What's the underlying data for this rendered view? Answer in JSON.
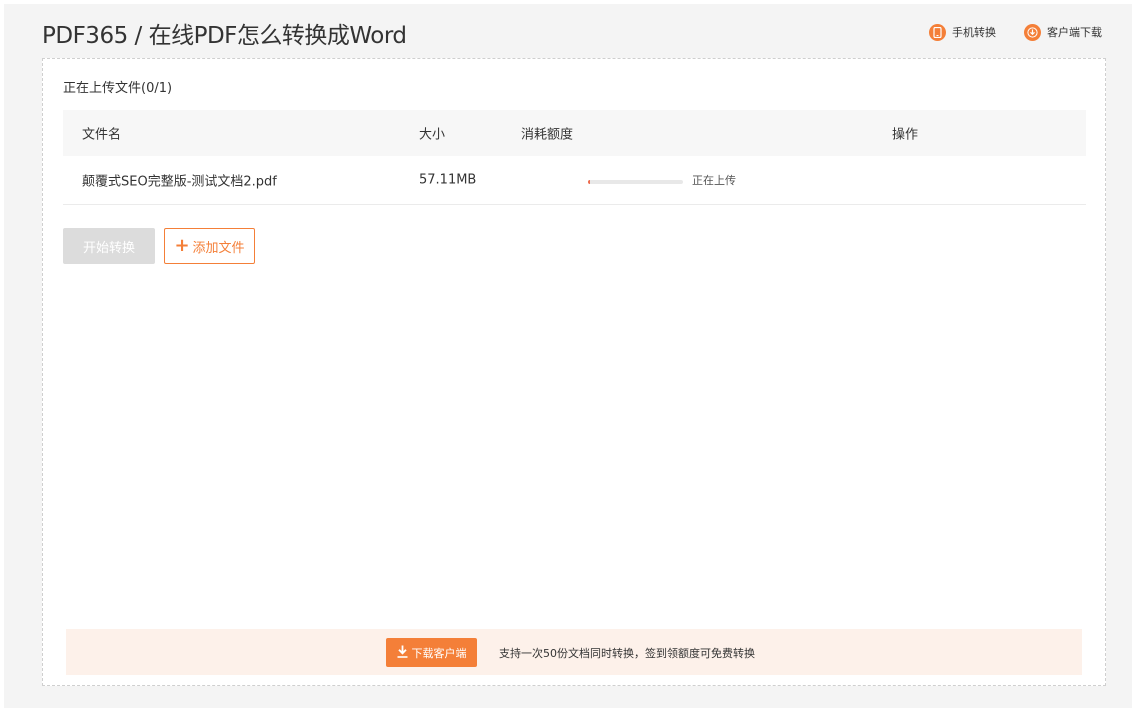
{
  "header": {
    "title": "PDF365 / 在线PDF怎么转换成Word",
    "links": {
      "mobile": {
        "label": "手机转换",
        "icon": "phone-icon"
      },
      "client": {
        "label": "客户端下载",
        "icon": "download-icon"
      }
    }
  },
  "colors": {
    "accent": "#f47f38",
    "progress": "#ee6b4d",
    "disabled": "#dcdcdc",
    "notice_bg": "#fdf1ea"
  },
  "upload": {
    "status": "正在上传文件(0/1)"
  },
  "table": {
    "columns": [
      "文件名",
      "大小",
      "消耗额度",
      "操作"
    ],
    "rows": [
      {
        "file_name": "颠覆式SEO完整版-测试文档2.pdf",
        "size": "57.11MB",
        "progress": 0.02,
        "status": "正在上传"
      }
    ]
  },
  "actions": {
    "start_label": "开始转换",
    "add_label": "添加文件"
  },
  "footer": {
    "download_label": "下载客户端",
    "note": "支持一次50份文档同时转换，签到领额度可免费转换"
  }
}
